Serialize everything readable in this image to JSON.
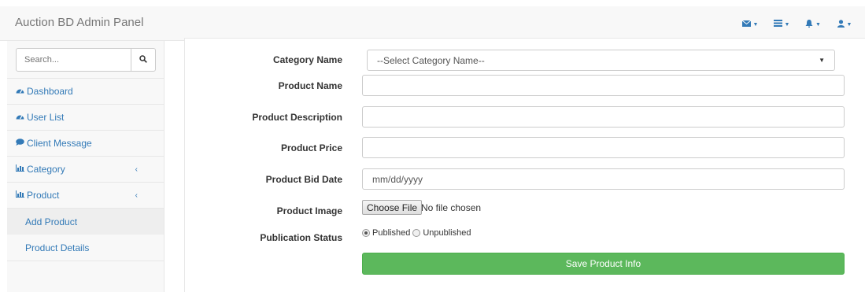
{
  "header": {
    "brand": "Auction BD Admin Panel",
    "icons": [
      "envelope-icon",
      "tasks-icon",
      "bell-icon",
      "user-icon"
    ],
    "accent_color": "#337ab7"
  },
  "sidebar": {
    "search_placeholder": "Search...",
    "items": [
      {
        "label": "Dashboard",
        "icon": "dashboard-icon"
      },
      {
        "label": "User List",
        "icon": "dashboard-icon"
      },
      {
        "label": "Client Message",
        "icon": "comment-icon"
      },
      {
        "label": "Category",
        "icon": "bar-chart-icon"
      },
      {
        "label": "Product",
        "icon": "bar-chart-icon"
      }
    ],
    "sub_items": [
      {
        "label": "Add Product"
      },
      {
        "label": "Product Details"
      }
    ]
  },
  "form": {
    "category_label": "Category Name",
    "category_value": "--Select Category Name--",
    "name_label": "Product Name",
    "name_value": "",
    "description_label": "Product Description",
    "description_value": "",
    "price_label": "Product Price",
    "price_value": "",
    "bid_date_label": "Product Bid Date",
    "bid_date_placeholder": "mm/dd/yyyy",
    "image_label": "Product Image",
    "choose_file_label": "Choose File",
    "no_file_text": "No file chosen",
    "status_label": "Publication Status",
    "status_options": [
      "Published",
      "Unpublished"
    ],
    "status_selected": "Published",
    "save_label": "Save Product Info",
    "save_color": "#5cb85c"
  }
}
